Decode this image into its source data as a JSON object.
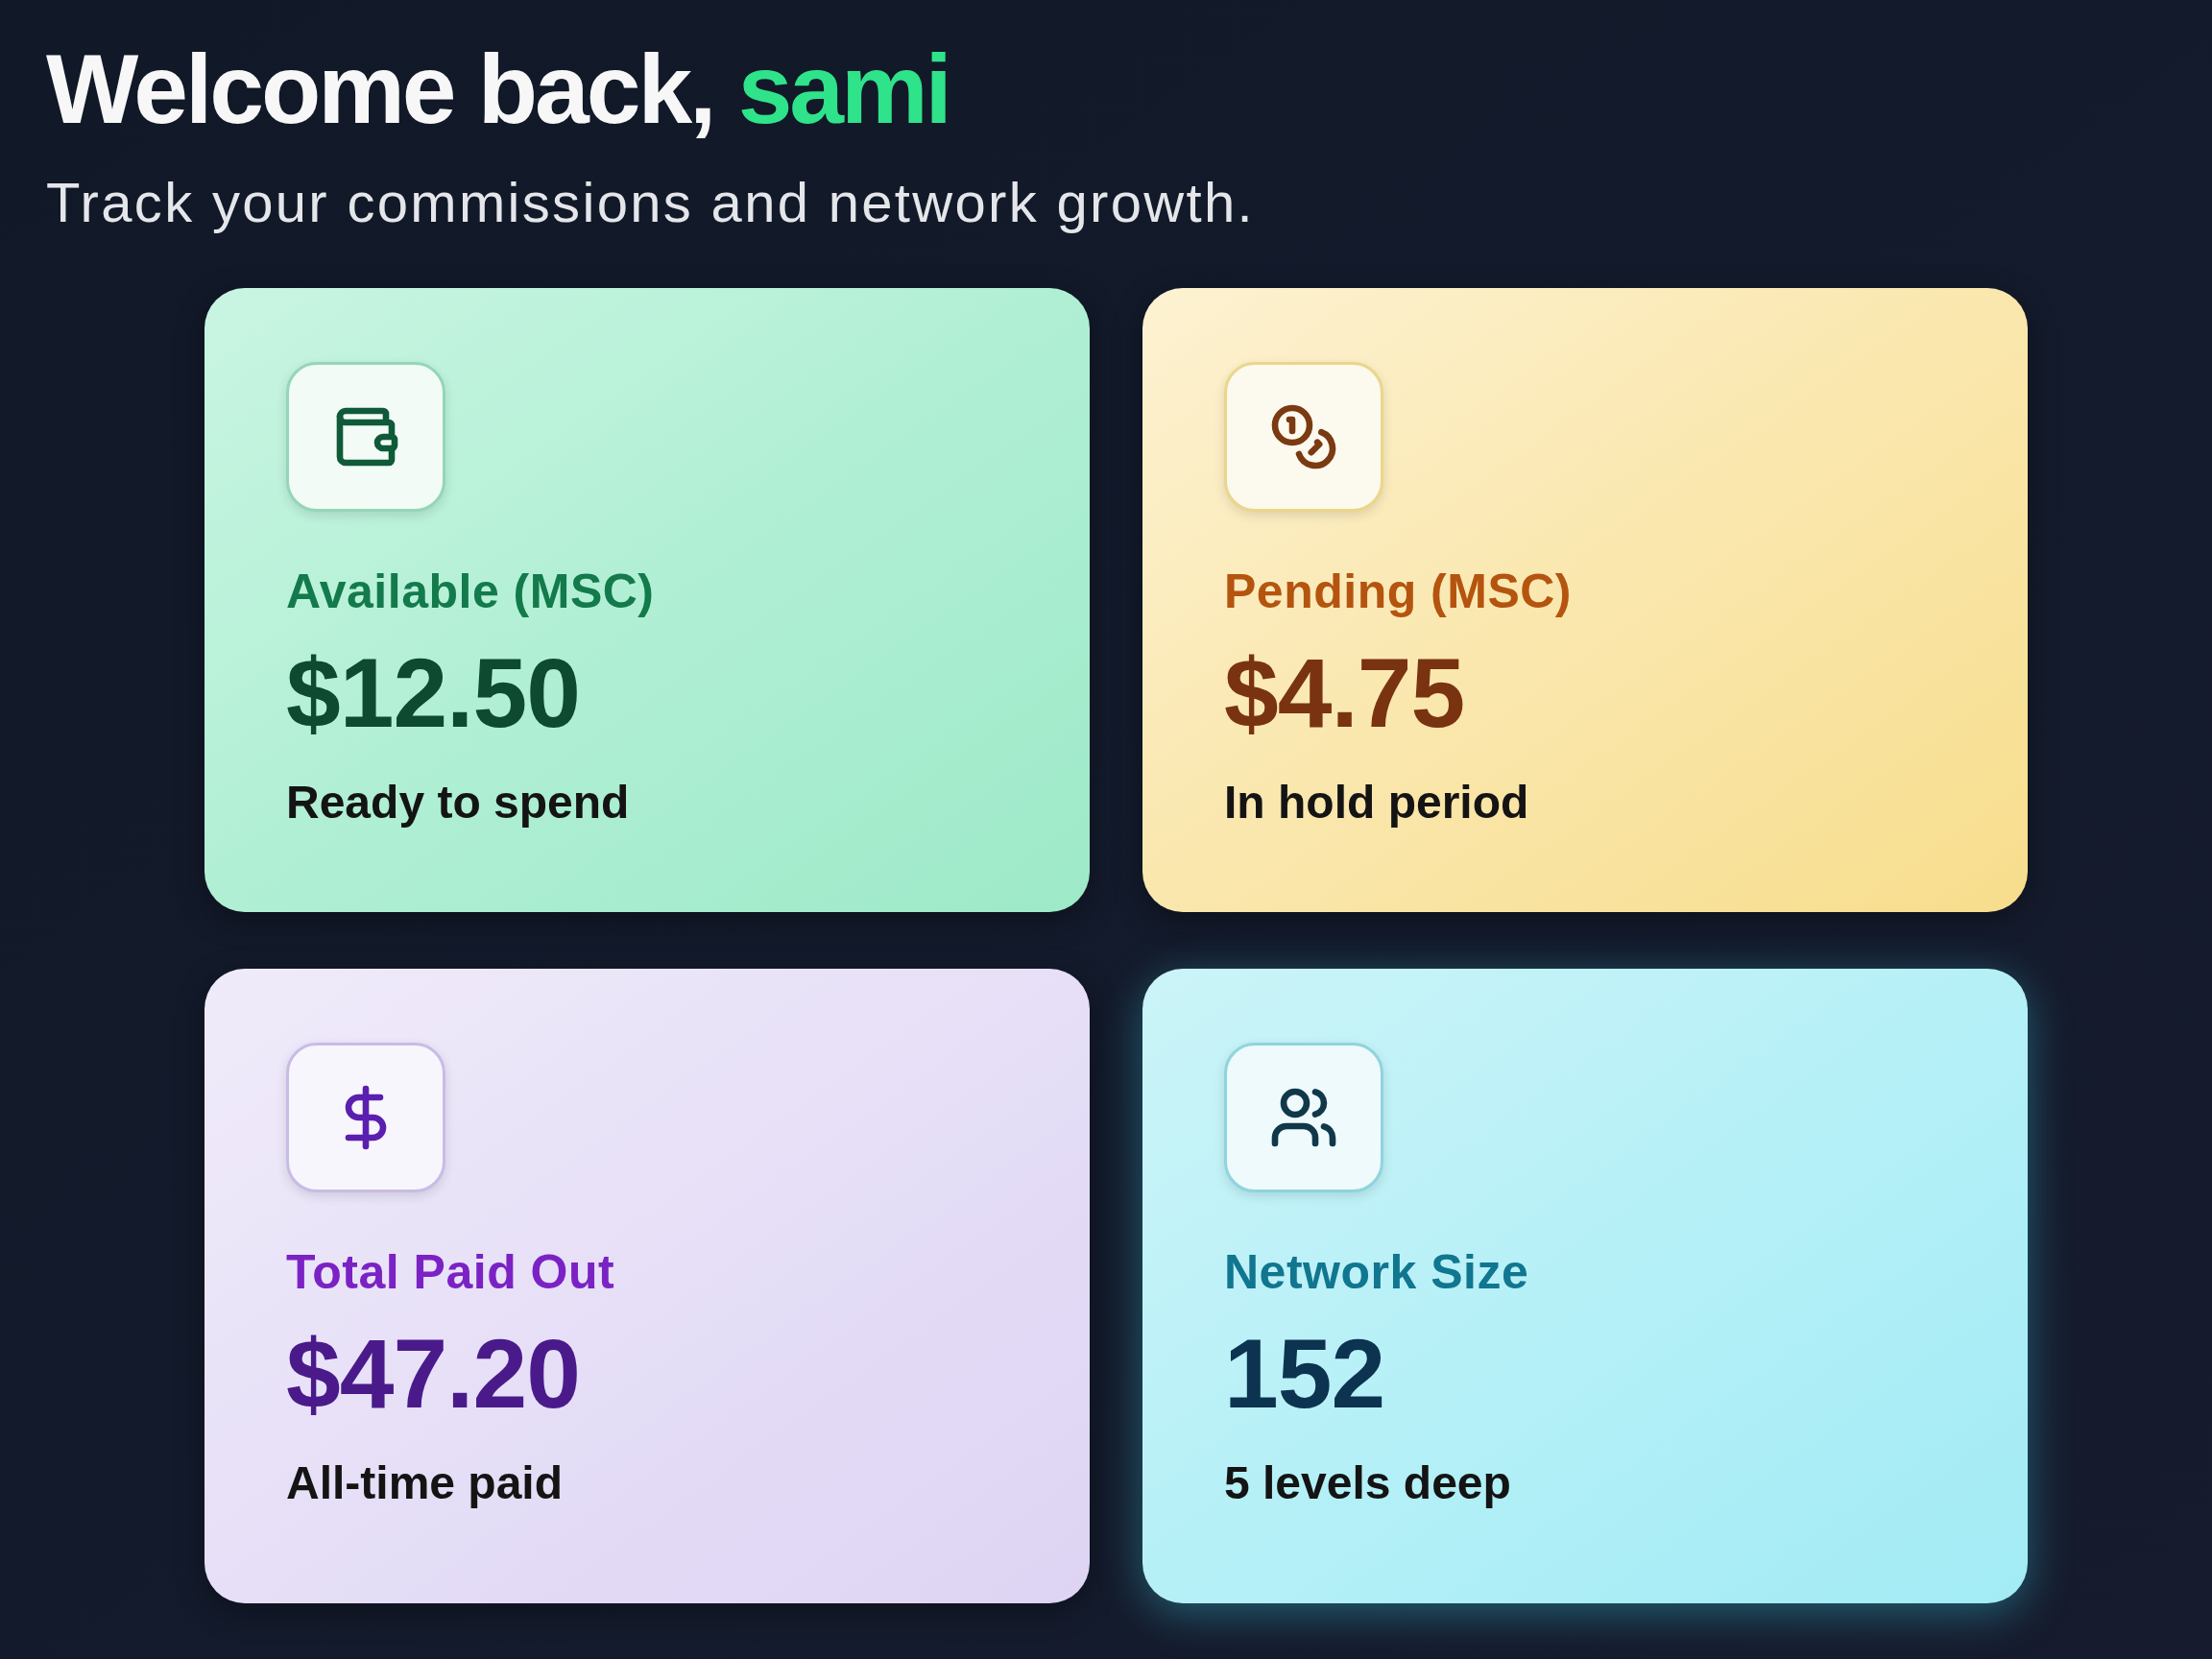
{
  "header": {
    "greeting": "Welcome back,",
    "name": "sami",
    "subtitle": "Track your commissions and network growth."
  },
  "cards": [
    {
      "kind": "available",
      "label": "Available (MSC)",
      "value": "$12.50",
      "caption": "Ready to spend"
    },
    {
      "kind": "pending",
      "label": "Pending (MSC)",
      "value": "$4.75",
      "caption": "In hold period"
    },
    {
      "kind": "paid",
      "label": "Total Paid Out",
      "value": "$47.20",
      "caption": "All-time paid"
    },
    {
      "kind": "network",
      "label": "Network Size",
      "value": "152",
      "caption": "5 levels deep"
    }
  ]
}
